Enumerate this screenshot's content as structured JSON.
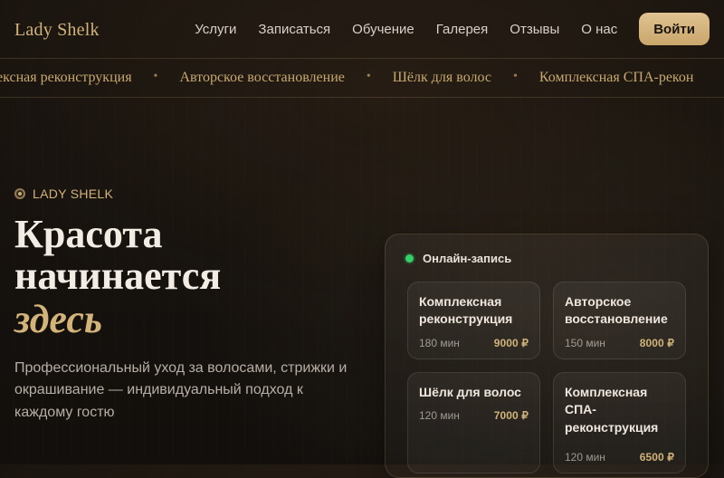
{
  "brand": "Lady Shelk",
  "nav": {
    "items": [
      "Услуги",
      "Записаться",
      "Обучение",
      "Галерея",
      "Отзывы",
      "О нас"
    ],
    "login_label": "Войти"
  },
  "marquee": {
    "items": [
      "лексная реконструкция",
      "Авторское восстановление",
      "Шёлк для волос",
      "Комплексная СПА-рекон"
    ],
    "separator": "•"
  },
  "hero": {
    "kicker": "LADY SHELK",
    "title_line1": "Красота",
    "title_line2": "начинается",
    "title_accent": "здесь",
    "lead": "Профессиональный уход за волосами, стрижки и окрашивание — индивидуальный подход к каждому гостю"
  },
  "booking": {
    "status_label": "Онлайн-запись",
    "services": [
      {
        "title": "Комплексная реконструкция",
        "duration": "180 мин",
        "price": "9000 ₽"
      },
      {
        "title": "Авторское восстановление",
        "duration": "150 мин",
        "price": "8000 ₽"
      },
      {
        "title": "Шёлк для волос",
        "duration": "120 мин",
        "price": "7000 ₽"
      },
      {
        "title": "Комплексная СПА-реконструкция",
        "duration": "120 мин",
        "price": "6500 ₽"
      }
    ]
  },
  "colors": {
    "accent": "#d2b37a",
    "background": "#120f0c",
    "online_status": "#33d16a"
  }
}
